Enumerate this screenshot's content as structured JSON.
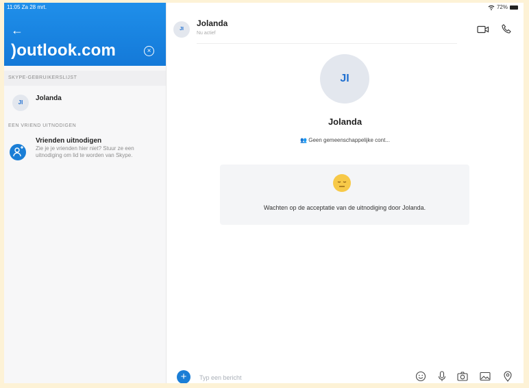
{
  "status": {
    "time_date": "11:05  Za 28 mrt.",
    "battery": "72%"
  },
  "sidebar": {
    "search_value": ")outlook.com",
    "section_users": "SKYPE-GEBRUIKERSLIJST",
    "contact": {
      "initials": "JI",
      "name": "Jolanda"
    },
    "section_invite": "EEN VRIEND UITNODIGEN",
    "invite": {
      "title": "Vrienden uitnodigen",
      "description": "Zie je je vrienden hier niet? Stuur ze een uitnodiging om lid te worden van Skype."
    }
  },
  "chat": {
    "header": {
      "initials": "JI",
      "name": "Jolanda",
      "status": "Nu actief"
    },
    "profile": {
      "initials": "JI",
      "name": "Jolanda",
      "mutual": "Geen gemeenschappelijke cont..."
    },
    "waiting_message": "Wachten op de acceptatie van de uitnodiging door Jolanda.",
    "composer": {
      "placeholder": "Typ een bericht"
    }
  },
  "icons": {
    "back": "arrow-left-icon",
    "clear": "clear-icon",
    "invite": "add-person-icon",
    "video": "video-call-icon",
    "call": "phone-icon",
    "plus": "plus-icon",
    "emoji": "emoji-icon",
    "mic": "microphone-icon",
    "camera": "camera-icon",
    "gallery": "gallery-icon",
    "location": "location-icon",
    "mutual": "contacts-icon"
  },
  "colors": {
    "brand": "#1a7ed6",
    "header_gradient_top": "#1f8fea",
    "avatar_bg": "#e3e7ee"
  }
}
